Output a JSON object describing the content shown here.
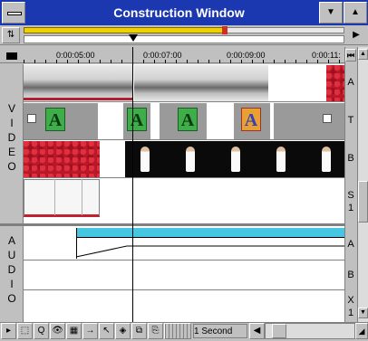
{
  "window": {
    "title": "Construction Window"
  },
  "timecodes": [
    "0:00:05:00",
    "0:00:07:00",
    "0:00:09:00",
    "0:00:11:"
  ],
  "video": {
    "label_letters": [
      "V",
      "I",
      "D",
      "E",
      "O"
    ],
    "tracks": [
      {
        "name": "A"
      },
      {
        "name": "T"
      },
      {
        "name": "B"
      },
      {
        "name": "S",
        "sub": "1"
      }
    ]
  },
  "audio": {
    "label_letters": [
      "A",
      "U",
      "D",
      "I",
      "O"
    ],
    "tracks": [
      {
        "name": "A"
      },
      {
        "name": "B"
      },
      {
        "name": "X",
        "sub": "1"
      }
    ]
  },
  "transition_glyph": "A",
  "toolbar": {
    "tools": [
      "▸",
      "⬚",
      "Q",
      "👁",
      "▦",
      "→",
      "↖",
      "◈",
      "⧉",
      "⎘"
    ],
    "zoom_value": "1 Second"
  },
  "colors": {
    "title_bar": "#1c38b0",
    "work_area": "#f0d000",
    "audio_bar": "#46c6e0"
  }
}
